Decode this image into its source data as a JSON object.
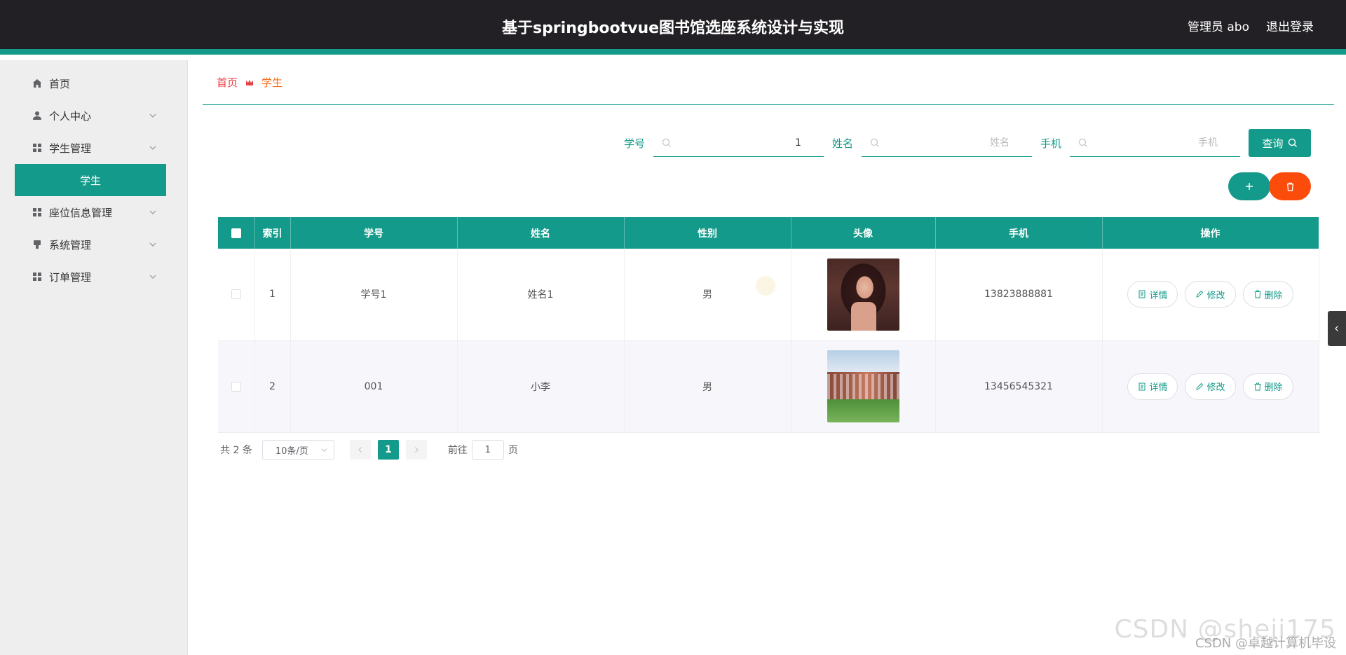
{
  "header": {
    "title": "基于springbootvue图书馆选座系统设计与实现",
    "user_label": "管理员 abo",
    "logout_label": "退出登录"
  },
  "sidebar": {
    "items": [
      {
        "label": "首页",
        "icon": "home-icon"
      },
      {
        "label": "个人中心",
        "icon": "user-icon"
      },
      {
        "label": "学生管理",
        "icon": "grid-icon"
      },
      {
        "label": "学生",
        "icon": ""
      },
      {
        "label": "座位信息管理",
        "icon": "grid-icon"
      },
      {
        "label": "系统管理",
        "icon": "settings-icon"
      },
      {
        "label": "订单管理",
        "icon": "grid-icon"
      }
    ]
  },
  "breadcrumb": {
    "home": "首页",
    "current": "学生"
  },
  "search": {
    "student_id_label": "学号",
    "student_id_value": "1",
    "name_label": "姓名",
    "name_placeholder": "姓名",
    "phone_label": "手机",
    "phone_placeholder": "手机",
    "query_label": "查询"
  },
  "table": {
    "columns": [
      "索引",
      "学号",
      "姓名",
      "性别",
      "头像",
      "手机",
      "操作"
    ],
    "rows": [
      {
        "index": "1",
        "student_id": "学号1",
        "name": "姓名1",
        "gender": "男",
        "phone": "13823888881"
      },
      {
        "index": "2",
        "student_id": "001",
        "name": "小李",
        "gender": "男",
        "phone": "13456545321"
      }
    ],
    "actions": {
      "detail": "详情",
      "edit": "修改",
      "delete": "删除"
    }
  },
  "pagination": {
    "total": "共 2 条",
    "page_size": "10条/页",
    "current_page": "1",
    "goto_prefix": "前往",
    "goto_value": "1",
    "goto_suffix": "页"
  },
  "watermark": {
    "large": "CSDN @sheji175",
    "small": "CSDN @卓越计算机毕设"
  },
  "colors": {
    "primary": "#139a8a",
    "danger": "#fc4c0c",
    "header_bg": "#222024"
  }
}
